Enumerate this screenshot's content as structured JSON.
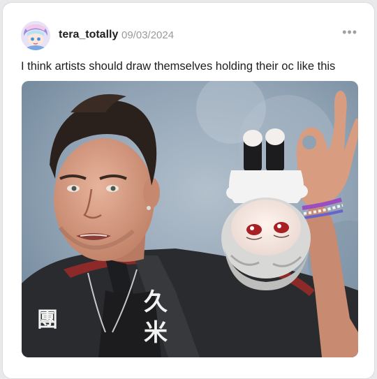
{
  "post": {
    "username": "tera_totally",
    "date": "09/03/2024",
    "more_icon": "more-horizontal-icon",
    "more_glyph": "•••",
    "caption": "I think artists should draw themselves holding their oc like this",
    "shirt_kanji_left": "團",
    "shirt_kanji_right_top": "久",
    "shirt_kanji_right_bottom": "米"
  },
  "colors": {
    "card_bg": "#ffffff",
    "page_bg": "#e9e9ec",
    "username": "#1f1f1f",
    "date": "#9a9a9a",
    "backdrop": "#8fa2b4"
  }
}
